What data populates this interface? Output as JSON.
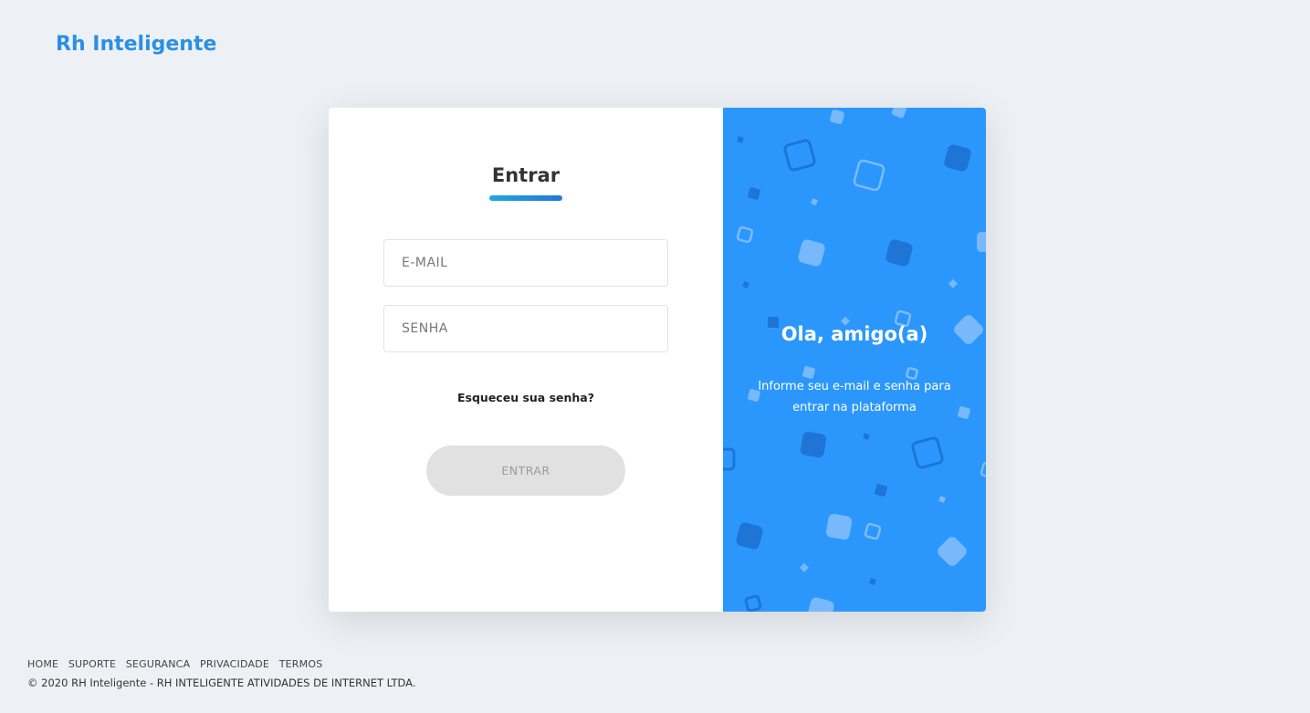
{
  "brand": {
    "name": "Rh Inteligente",
    "color": "#2b8fe6"
  },
  "login": {
    "title": "Entrar",
    "email_placeholder": "E-MAIL",
    "password_placeholder": "SENHA",
    "forgot_label": "Esqueceu sua senha?",
    "submit_label": "ENTRAR"
  },
  "welcome": {
    "heading": "Ola, amigo(a)",
    "message": "Informe seu e-mail e senha para entrar na plataforma",
    "background_color": "#2b97fd"
  },
  "footer": {
    "links": [
      "HOME",
      "SUPORTE",
      "SEGURANCA",
      "PRIVACIDADE",
      "TERMOS"
    ],
    "copyright": "© 2020 RH Inteligente - RH INTELIGENTE ATIVIDADES DE INTERNET LTDA."
  }
}
